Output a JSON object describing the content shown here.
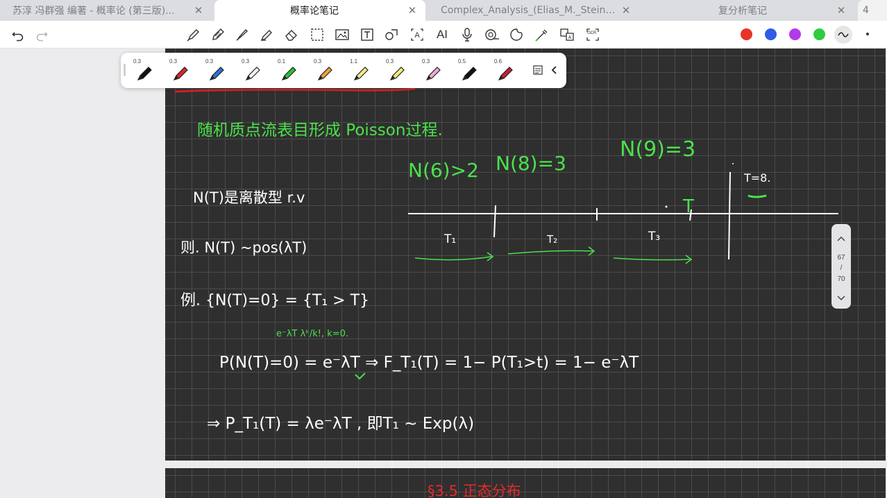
{
  "tabs": [
    {
      "label": "苏淳 冯群强 编著 - 概率论 (第三版)...",
      "active": false
    },
    {
      "label": "概率论笔记",
      "active": true
    },
    {
      "label": "Complex_Analysis_(Elias_M._Stein,_...",
      "active": false
    },
    {
      "label": "复分析笔记",
      "active": false
    }
  ],
  "tab_overflow_count": "4",
  "toolbar": {
    "ocr_label": "OCR",
    "ai_label": "AI",
    "colors": [
      "#e8332a",
      "#2f5be8",
      "#b23ae8",
      "#2ecc40"
    ]
  },
  "pens": [
    {
      "size": "0.3",
      "color": "#111111"
    },
    {
      "size": "0.3",
      "color": "#d8262b"
    },
    {
      "size": "0.3",
      "color": "#2f6fd6"
    },
    {
      "size": "0.3",
      "color": "#f2f2f2"
    },
    {
      "size": "0.1",
      "color": "#2fbf3a"
    },
    {
      "size": "0.3",
      "color": "#e5a53a"
    },
    {
      "size": "1.1",
      "color": "#f1ea8a"
    },
    {
      "size": "0.3",
      "color": "#f4ea78"
    },
    {
      "size": "0.3",
      "color": "#f2a6d8"
    },
    {
      "size": "0.5",
      "color": "#111111"
    },
    {
      "size": "0.6",
      "color": "#c91f2f"
    }
  ],
  "page_nav": {
    "current": "67",
    "separator": "/",
    "total": "70"
  },
  "note": {
    "line_green_title": "随机质点流表目形成 Poisson过程.",
    "n9": "N(9)=3",
    "n6": "N(6)>2",
    "n8": "N(8)=3",
    "t_eq": "T=8.",
    "marker_t": "T",
    "discrete": "N(T)是离散型 r.v",
    "pois": "则. N(T) ~pos(λT)",
    "example": "例.  {N(T)=0} = {T₁ > T}",
    "hint": "e⁻λT λᵏ/k!, k=0.",
    "p_eq": "P(N(T)=0) = e⁻λT ⇒ F_T₁(T) = 1− P(T₁>t) = 1− e⁻λT",
    "density": "⇒ P_T₁(T) = λe⁻λT ,  即T₁ ~ Exp(λ)",
    "t1": "T₁",
    "t2": "T₂",
    "t3": "T₃",
    "next_title": "§3.5   正态分布"
  }
}
